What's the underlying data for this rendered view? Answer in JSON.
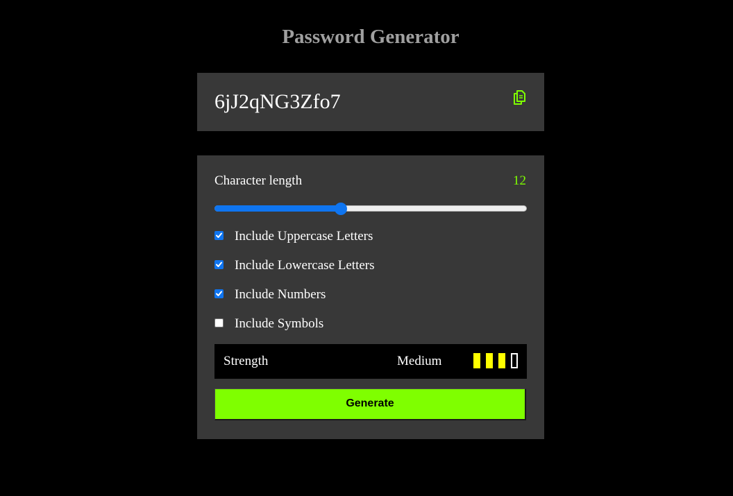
{
  "app": {
    "title": "Password Generator"
  },
  "password": {
    "value": "6jJ2qNG3Zfo7",
    "copy_icon": "copy-icon",
    "accent_color": "#7fff00"
  },
  "length": {
    "label": "Character length",
    "value": "12",
    "slider_fraction": 0.4
  },
  "options": [
    {
      "label": "Include Uppercase Letters",
      "checked": true
    },
    {
      "label": "Include Lowercase Letters",
      "checked": true
    },
    {
      "label": "Include Numbers",
      "checked": true
    },
    {
      "label": "Include Symbols",
      "checked": false
    }
  ],
  "strength": {
    "label": "Strength",
    "value": "Medium",
    "bars_filled": 3,
    "bars_total": 4,
    "bar_color": "#ffff00"
  },
  "generate": {
    "label": "Generate",
    "color": "#7fff00"
  }
}
